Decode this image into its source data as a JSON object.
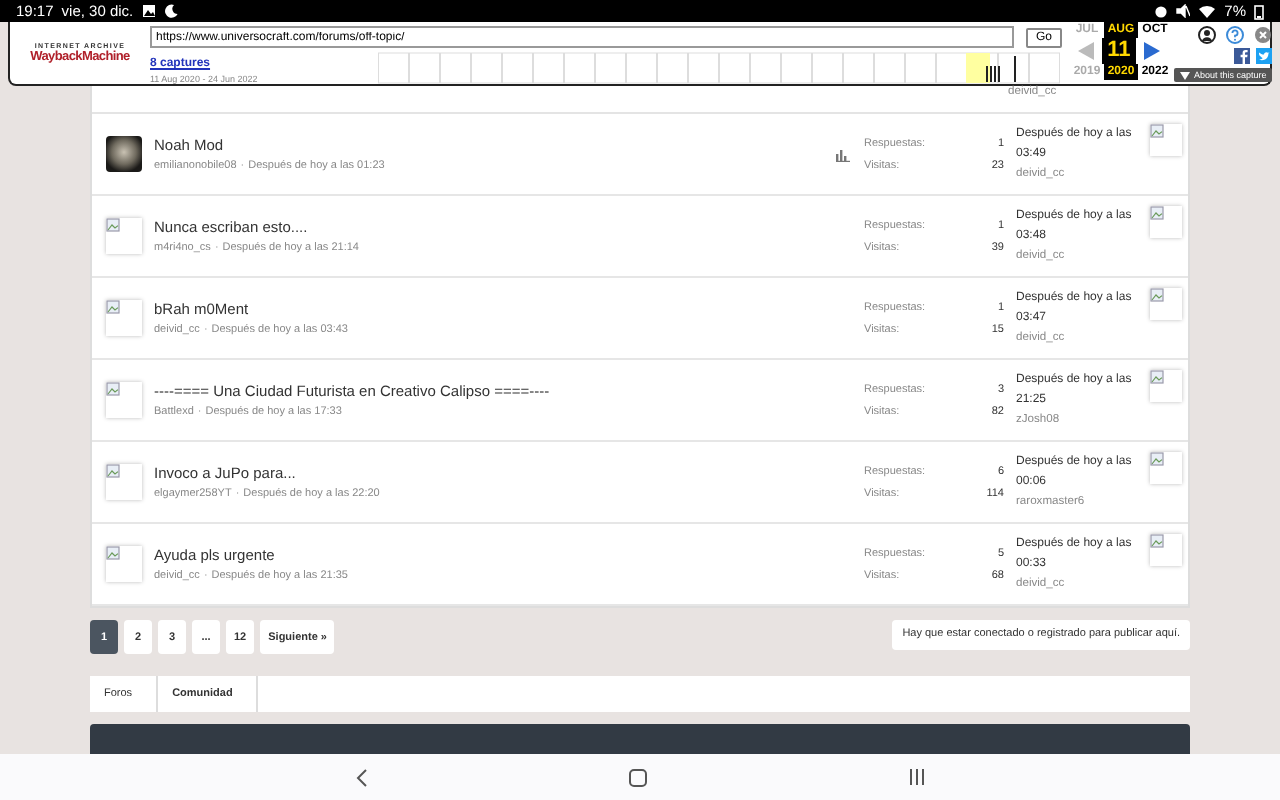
{
  "status_bar": {
    "time": "19:17",
    "date": "vie, 30 dic.",
    "battery": "7%"
  },
  "wayback": {
    "logo_top": "INTERNET ARCHIVE",
    "logo": "WaybackMachine",
    "url": "https://www.universocraft.com/forums/off-topic/",
    "go": "Go",
    "captures": "8 captures",
    "range": "11 Aug 2020 - 24 Jun 2022",
    "months": [
      {
        "label": "JUL",
        "selected": false
      },
      {
        "label": "AUG",
        "selected": true
      },
      {
        "label": "OCT",
        "selected": false
      }
    ],
    "day": "11",
    "years": [
      {
        "label": "2019",
        "selected": false
      },
      {
        "label": "2020",
        "selected": true
      },
      {
        "label": "2022",
        "selected": false
      }
    ],
    "about": "About this capture"
  },
  "partial_row": {
    "last_user": "deivid_cc"
  },
  "threads": [
    {
      "kind": "photo",
      "title": "Noah Mod",
      "author": "emilianonobile08",
      "separator": "·",
      "started": "Después de hoy a las 01:23",
      "chart_icon": true,
      "replies_label": "Respuestas:",
      "replies": "1",
      "views_label": "Visitas:",
      "views": "23",
      "last_date": "Después de hoy a las 03:49",
      "last_user": "deivid_cc"
    },
    {
      "kind": "broken",
      "title": "Nunca escriban esto....",
      "author": "m4ri4no_cs",
      "separator": "·",
      "started": "Después de hoy a las 21:14",
      "chart_icon": false,
      "replies_label": "Respuestas:",
      "replies": "1",
      "views_label": "Visitas:",
      "views": "39",
      "last_date": "Después de hoy a las 03:48",
      "last_user": "deivid_cc"
    },
    {
      "kind": "broken",
      "title": "bRah m0Ment",
      "author": "deivid_cc",
      "separator": "·",
      "started": "Después de hoy a las 03:43",
      "chart_icon": false,
      "replies_label": "Respuestas:",
      "replies": "1",
      "views_label": "Visitas:",
      "views": "15",
      "last_date": "Después de hoy a las 03:47",
      "last_user": "deivid_cc"
    },
    {
      "kind": "broken",
      "title": "----==== Una Ciudad Futurista en Creativo Calipso ====----",
      "author": "Battlexd",
      "separator": "·",
      "started": "Después de hoy a las 17:33",
      "chart_icon": false,
      "replies_label": "Respuestas:",
      "replies": "3",
      "views_label": "Visitas:",
      "views": "82",
      "last_date": "Después de hoy a las 21:25",
      "last_user": "zJosh08"
    },
    {
      "kind": "broken",
      "title": "Invoco a JuPo para...",
      "author": "elgaymer258YT",
      "separator": "·",
      "started": "Después de hoy a las 22:20",
      "chart_icon": false,
      "replies_label": "Respuestas:",
      "replies": "6",
      "views_label": "Visitas:",
      "views": "114",
      "last_date": "Después de hoy a las 00:06",
      "last_user": "raroxmaster6"
    },
    {
      "kind": "broken",
      "title": "Ayuda pls urgente",
      "author": "deivid_cc",
      "separator": "·",
      "started": "Después de hoy a las 21:35",
      "chart_icon": false,
      "replies_label": "Respuestas:",
      "replies": "5",
      "views_label": "Visitas:",
      "views": "68",
      "last_date": "Después de hoy a las 00:33",
      "last_user": "deivid_cc"
    }
  ],
  "pagination": [
    {
      "label": "1",
      "selected": true
    },
    {
      "label": "2",
      "selected": false
    },
    {
      "label": "3",
      "selected": false
    },
    {
      "label": "...",
      "selected": false
    },
    {
      "label": "12",
      "selected": false
    },
    {
      "label": "Siguiente »",
      "selected": false
    }
  ],
  "login_notice": "Hay que estar conectado o registrado para publicar aquí.",
  "breadcrumb": [
    {
      "label": "Foros",
      "current": false
    },
    {
      "label": "Comunidad",
      "current": true
    }
  ]
}
